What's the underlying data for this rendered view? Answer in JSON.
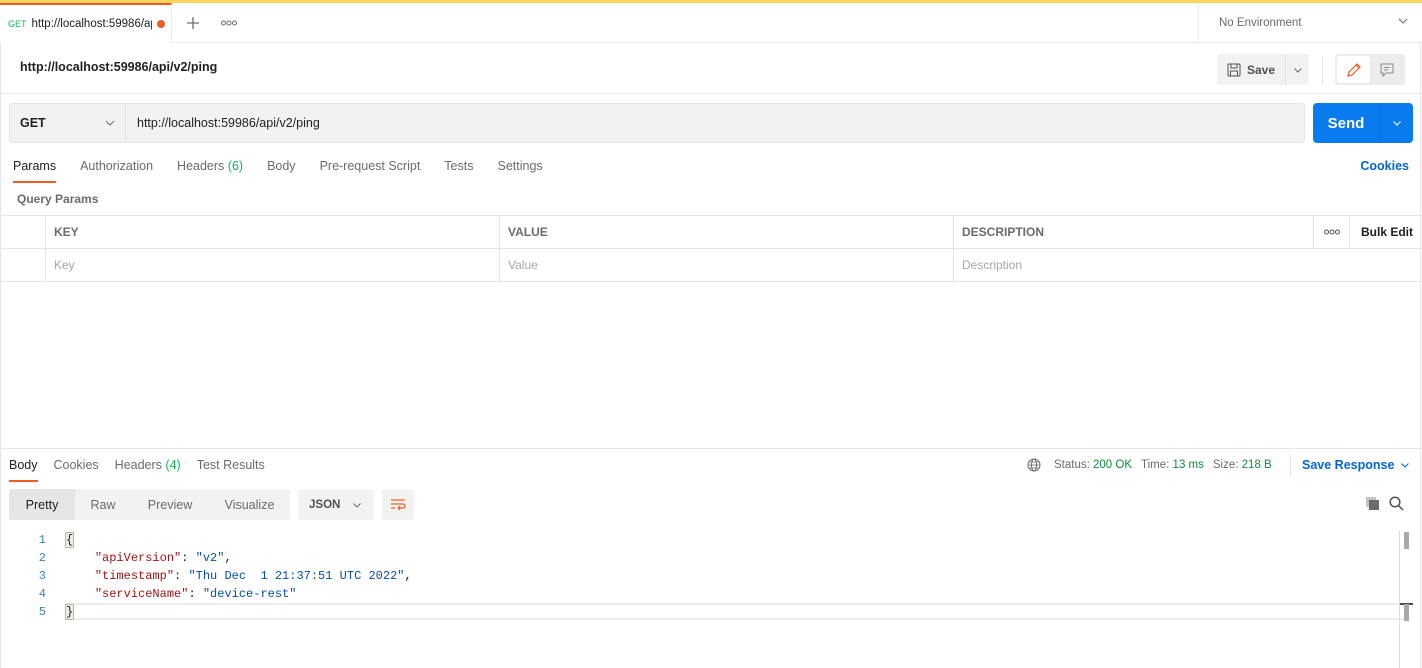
{
  "tabbar": {
    "active_tab": {
      "method": "GET",
      "title": "http://localhost:59986/api/v2/ping",
      "unsaved": true
    },
    "add_tab_icon": "plus-icon",
    "more_icon": "ellipsis-icon",
    "environment": "No Environment"
  },
  "header": {
    "request_name": "http://localhost:59986/api/v2/ping",
    "save_label": "Save"
  },
  "request": {
    "method": "GET",
    "url": "http://localhost:59986/api/v2/ping",
    "send_label": "Send",
    "tabs": [
      {
        "label": "Params",
        "active": true
      },
      {
        "label": "Authorization"
      },
      {
        "label": "Headers",
        "count": "(6)"
      },
      {
        "label": "Body"
      },
      {
        "label": "Pre-request Script"
      },
      {
        "label": "Tests"
      },
      {
        "label": "Settings"
      }
    ],
    "cookies_link": "Cookies",
    "query_params_label": "Query Params",
    "params_table": {
      "headers": [
        "KEY",
        "VALUE",
        "DESCRIPTION"
      ],
      "more_icon": "ellipsis-icon",
      "bulk_edit": "Bulk Edit",
      "placeholders": {
        "key": "Key",
        "value": "Value",
        "description": "Description"
      }
    }
  },
  "response": {
    "tabs": [
      {
        "label": "Body",
        "active": true
      },
      {
        "label": "Cookies"
      },
      {
        "label": "Headers",
        "count": "(4)"
      },
      {
        "label": "Test Results"
      }
    ],
    "status_label": "Status:",
    "status_value": "200 OK",
    "time_label": "Time:",
    "time_value": "13 ms",
    "size_label": "Size:",
    "size_value": "218 B",
    "save_response": "Save Response",
    "formats": [
      "Pretty",
      "Raw",
      "Preview",
      "Visualize"
    ],
    "active_format": "Pretty",
    "language": "JSON",
    "body_lines": [
      {
        "n": "1",
        "text": "{"
      },
      {
        "n": "2",
        "key": "\"apiVersion\"",
        "value": "\"v2\"",
        "trail": ","
      },
      {
        "n": "3",
        "key": "\"timestamp\"",
        "value": "\"Thu Dec  1 21:37:51 UTC 2022\"",
        "trail": ","
      },
      {
        "n": "4",
        "key": "\"serviceName\"",
        "value": "\"device-rest\"",
        "trail": ""
      },
      {
        "n": "5",
        "text": "}"
      }
    ]
  },
  "colors": {
    "accent": "#ef5b25",
    "primary": "#097bed",
    "link": "#0265d2",
    "success": "#0cbb52"
  }
}
